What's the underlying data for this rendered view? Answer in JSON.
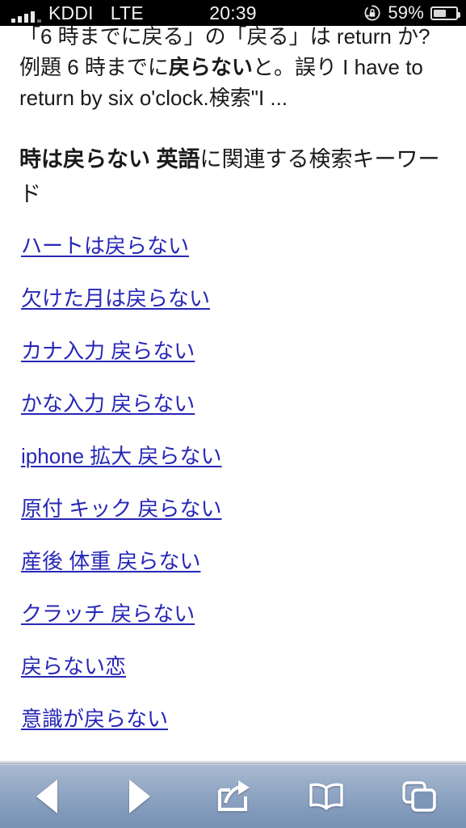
{
  "statusbar": {
    "carrier": "KDDI",
    "network": "LTE",
    "time": "20:39",
    "battery_percent": "59%",
    "battery_level": 59,
    "signal_bars": 4,
    "signal_bars_total": 5,
    "rotation_lock_icon": "rotation-lock-icon",
    "battery_icon": "battery-icon"
  },
  "page": {
    "snippet": {
      "line1_pre": "「6 時までに戻る」の「戻る」は return か?例題 6 時までに",
      "bold": "戻らない",
      "line1_post": "と。誤り I have to return by six o'clock.検索\"I ..."
    },
    "keywords_heading": {
      "bold": "時は戻らない 英語",
      "rest": "に関連する検索キーワード"
    },
    "keywords": [
      "ハートは戻らない",
      "欠けた月は戻らない",
      "カナ入力 戻らない",
      "かな入力 戻らない",
      "iphone 拡大 戻らない",
      "原付 キック 戻らない",
      "産後 体重 戻らない",
      "クラッチ 戻らない",
      "戻らない恋",
      "意識が戻らない"
    ]
  },
  "toolbar": {
    "back_label": "back-arrow",
    "forward_label": "forward-arrow",
    "share_label": "share",
    "bookmarks_label": "bookmarks",
    "tabs_label": "tabs"
  },
  "colors": {
    "link": "#2727b6",
    "text": "#1a1a1a",
    "statusbar_bg": "#000000",
    "toolbar_top": "#aabbd2",
    "toolbar_bottom": "#7992b4",
    "page_bg": "#ffffff"
  }
}
